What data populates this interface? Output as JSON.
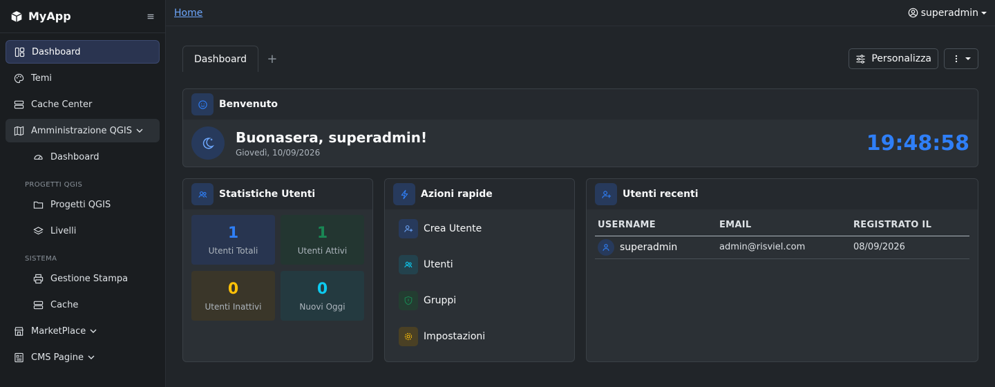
{
  "app": {
    "name": "MyApp"
  },
  "sidebar": {
    "items": [
      {
        "label": "Dashboard"
      },
      {
        "label": "Temi"
      },
      {
        "label": "Cache Center"
      },
      {
        "label": "Amministrazione QGIS"
      }
    ],
    "qgis": {
      "dashboard": "Dashboard",
      "section_projects": "PROGETTI QGIS",
      "projects": "Progetti QGIS",
      "layers": "Livelli",
      "section_system": "SISTEMA",
      "print": "Gestione Stampa",
      "cache": "Cache"
    },
    "bottom": [
      {
        "label": "MarketPlace"
      },
      {
        "label": "CMS Pagine"
      }
    ]
  },
  "topbar": {
    "breadcrumb": "Home",
    "user": "superadmin"
  },
  "tabs": [
    {
      "label": "Dashboard"
    }
  ],
  "toolbar": {
    "customize": "Personalizza"
  },
  "welcome": {
    "title": "Benvenuto",
    "greeting": "Buonasera, superadmin!",
    "date": "Giovedì, 10/09/2026",
    "clock": "19:48:58"
  },
  "stats": {
    "title": "Statistiche Utenti",
    "items": [
      {
        "value": "1",
        "label": "Utenti Totali",
        "color": "#2f7ff7"
      },
      {
        "value": "1",
        "label": "Utenti Attivi",
        "color": "#198754"
      },
      {
        "value": "0",
        "label": "Utenti Inattivi",
        "color": "#ffc107"
      },
      {
        "value": "0",
        "label": "Nuovi Oggi",
        "color": "#0dcaf0"
      }
    ]
  },
  "quick_actions": {
    "title": "Azioni rapide",
    "items": [
      {
        "label": "Crea Utente",
        "icon": "user-plus-icon"
      },
      {
        "label": "Utenti",
        "icon": "users-icon"
      },
      {
        "label": "Gruppi",
        "icon": "shield-icon"
      },
      {
        "label": "Impostazioni",
        "icon": "gear-icon"
      }
    ]
  },
  "recent_users": {
    "title": "Utenti recenti",
    "columns": [
      "USERNAME",
      "EMAIL",
      "REGISTRATO IL"
    ],
    "rows": [
      {
        "username": "superadmin",
        "email": "admin@risviel.com",
        "registered": "08/09/2026"
      }
    ]
  },
  "colors": {
    "accent": "#2f7ff7",
    "link": "#6ea8fe"
  }
}
